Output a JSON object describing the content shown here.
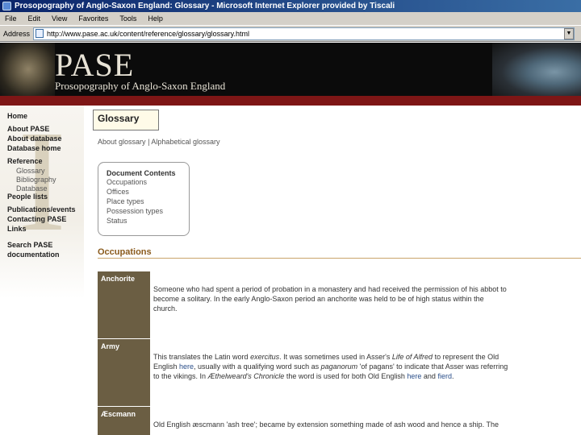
{
  "window": {
    "title": "Prosopography of Anglo-Saxon England: Glossary - Microsoft Internet Explorer provided by Tiscali"
  },
  "menu": [
    "File",
    "Edit",
    "View",
    "Favorites",
    "Tools",
    "Help"
  ],
  "address": {
    "label": "Address",
    "url": "http://www.pase.ac.uk/content/reference/glossary/glossary.html"
  },
  "banner": {
    "brand": "PASE",
    "subtitle": "Prosopography of Anglo-Saxon England"
  },
  "nav": {
    "items": [
      "Home",
      "About PASE",
      "About database",
      "Database home",
      "Reference",
      "People lists",
      "Publications/events",
      "Contacting PASE",
      "Links",
      "Search PASE documentation"
    ],
    "reference_sub": [
      "Glossary",
      "Bibliography",
      "Database"
    ]
  },
  "main": {
    "title": "Glossary",
    "links": {
      "about": "About glossary",
      "separator": "|",
      "alphabetical": "Alphabetical glossary"
    },
    "contents": {
      "title": "Document Contents",
      "items": [
        "Occupations",
        "Offices",
        "Place types",
        "Possession types",
        "Status"
      ]
    },
    "section": "Occupations",
    "occupations": [
      {
        "term": "Anchorite",
        "line1": "Someone who had spent a period of probation in a monastery and had received the permission of his abbot to",
        "line2": "become a solitary. In the early Anglo-Saxon period an anchorite was held to be of high status within the",
        "line3": "church."
      },
      {
        "term": "Army",
        "line1_a": "This translates the Latin word ",
        "line1_em": "exercitus",
        "line1_b": ". It was sometimes used in Asser's ",
        "line1_em2": "Life of Alfred",
        "line1_c": " to represent the Old",
        "line2_a": "English ",
        "line2_link": "here",
        "line2_b": ", usually with a qualifying word such as ",
        "line2_em": "paganorum",
        "line2_c": " 'of pagans' to indicate that Asser was referring",
        "line3_a": "to the vikings. In ",
        "line3_em": "Æthelweard's Chronicle",
        "line3_b": " the word is used for both Old English ",
        "line3_link1": "here",
        "line3_c": " and ",
        "line3_link2": "fierd",
        "line3_d": "."
      },
      {
        "term": "Æscmann",
        "line1": "Old English æscmann 'ash tree'; became by extension something made of ash wood and hence a ship. The"
      }
    ]
  }
}
